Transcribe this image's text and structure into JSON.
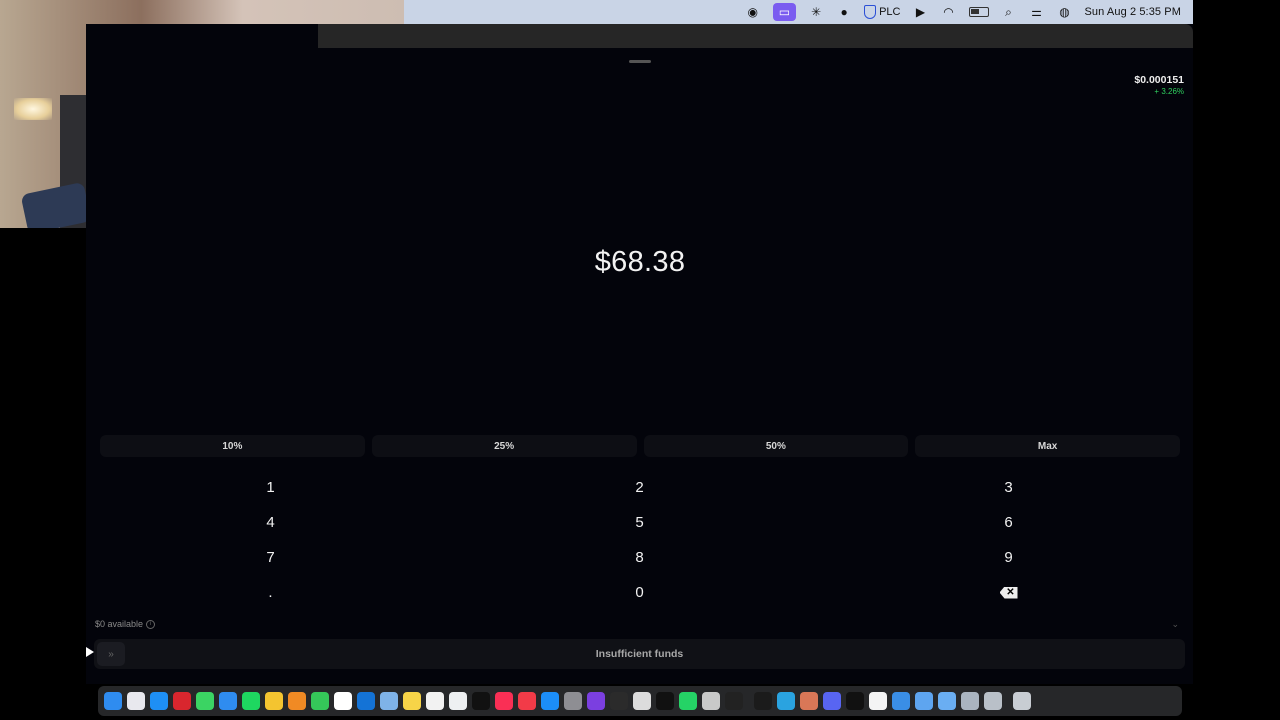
{
  "menubar": {
    "icons": [
      "screenshot-icon",
      "screen-record-icon",
      "perplexity-icon",
      "chat-icon",
      "vpn-shield-icon",
      "play-icon",
      "wifi-icon",
      "battery-icon",
      "search-icon",
      "control-center-icon",
      "siri-icon"
    ],
    "vpn_label": "PLC",
    "datetime": "Sun Aug 2  5:35 PM"
  },
  "ticker": {
    "price": "$0.000151",
    "change": "+ 3.26%"
  },
  "amount": "$68.38",
  "percent_buttons": [
    "10%",
    "25%",
    "50%",
    "Max"
  ],
  "keypad": {
    "rows": [
      [
        "1",
        "2",
        "3"
      ],
      [
        "4",
        "5",
        "6"
      ],
      [
        "7",
        "8",
        "9"
      ],
      [
        ".",
        "0",
        "backspace-icon"
      ]
    ]
  },
  "available_label": "$0 available",
  "submit_label": "Insufficient funds",
  "colors": {
    "background": "#03040b",
    "button_bg": "#0d0e14",
    "positive": "#2fcf5f",
    "menubar_bg": "#c9d4e6",
    "active_menu_item": "#7a5cf0"
  },
  "dock": {
    "icons": [
      "finder-icon",
      "launchpad-icon",
      "safari-icon",
      "opera-icon",
      "messages-icon",
      "mail-icon",
      "spotify-icon",
      "chrome-icon",
      "photos-icon",
      "facetime-icon",
      "calendar-icon",
      "outlook-icon",
      "preview-icon",
      "notes-icon",
      "reminders-icon",
      "freeform-icon",
      "tv-icon",
      "music-icon",
      "news-icon",
      "app-store-icon",
      "system-settings-icon",
      "onenote-icon",
      "activity-monitor-icon",
      "font-book-icon",
      "tiktok-icon",
      "whatsapp-icon",
      "script-editor-icon",
      "stocks-icon",
      "terminal-icon",
      "telegram-icon",
      "claude-icon",
      "discord-icon",
      "capcut-icon",
      "document-icon",
      "downloads-icon",
      "folder-icon",
      "folder-2-icon",
      "image-icon",
      "screenshot-stack-icon",
      "trash-icon"
    ]
  }
}
